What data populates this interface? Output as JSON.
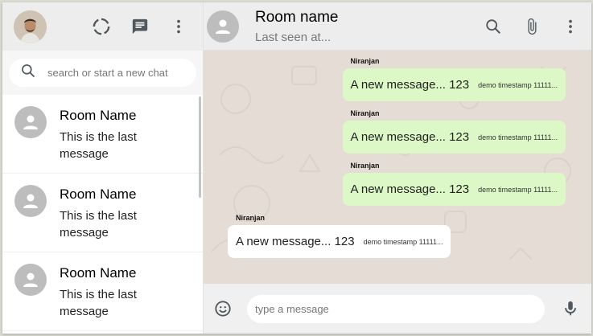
{
  "sidebar": {
    "search": {
      "placeholder": "search or start a new chat"
    },
    "chats": [
      {
        "name": "Room Name",
        "last_message": "This is the last message"
      },
      {
        "name": "Room Name",
        "last_message": "This is the last message"
      },
      {
        "name": "Room Name",
        "last_message": "This is the last message"
      }
    ],
    "icons": [
      "status-icon",
      "new-chat-icon",
      "more-vert-icon"
    ]
  },
  "chat": {
    "header": {
      "title": "Room name",
      "subtitle": "Last seen at..."
    },
    "icons": [
      "search-icon",
      "attach-icon",
      "more-vert-icon"
    ],
    "messages": [
      {
        "sender": "Niranjan",
        "text": "A new message... 123",
        "timestamp": "demo timestamp 11111...",
        "sent": true
      },
      {
        "sender": "Niranjan",
        "text": "A new message... 123",
        "timestamp": "demo timestamp 11111...",
        "sent": true
      },
      {
        "sender": "Niranjan",
        "text": "A new message... 123",
        "timestamp": "demo timestamp 11111...",
        "sent": true
      },
      {
        "sender": "Niranjan",
        "text": "A new message... 123",
        "timestamp": "demo timestamp 11111...",
        "sent": false
      }
    ],
    "footer": {
      "placeholder": "type a message"
    }
  },
  "colors": {
    "sent_bubble": "#dcf8c6",
    "recv_bubble": "#ffffff",
    "chat_bg": "#e5ddd5",
    "header_bg": "#ededed"
  }
}
